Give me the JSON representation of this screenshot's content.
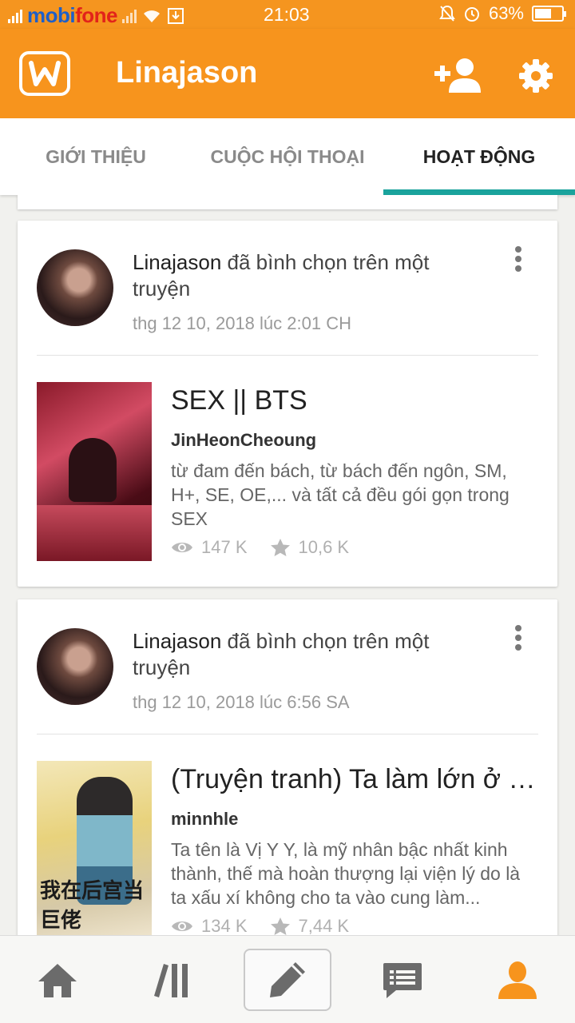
{
  "status_bar": {
    "carrier_part1": "mobi",
    "carrier_part2": "fone",
    "time": "21:03",
    "battery": "63%",
    "battery_level": 0.63
  },
  "app_bar": {
    "logo_letter": "w",
    "title": "Linajason",
    "icons": [
      "add-user-icon",
      "gear-icon"
    ]
  },
  "tabs": [
    {
      "label": "GIỚI THIỆU",
      "active": false
    },
    {
      "label": "CUỘC HỘI THOẠI",
      "active": false
    },
    {
      "label": "HOẠT ĐỘNG",
      "active": true
    }
  ],
  "activities": [
    {
      "user": "Linajason",
      "action": " đã bình chọn trên một truyện",
      "date": "thg 12 10, 2018 lúc 2:01 CH",
      "story": {
        "title": "SEX || BTS",
        "author": "JinHeonCheoung",
        "description": "từ đam đến bách, từ bách đến ngôn, SM, H+, SE, OE,...  và tất cả đều gói gọn trong SEX",
        "reads": "147 K",
        "votes": "10,6 K"
      }
    },
    {
      "user": "Linajason",
      "action": " đã bình chọn trên một truyện",
      "date": "thg 12 10, 2018 lúc 6:56 SA",
      "story": {
        "title": "(Truyện tranh) Ta làm lớn ở hậu cung",
        "author": "minnhle",
        "description": "Ta tên là Vị Y Y, là mỹ nhân bậc nhất kinh thành, thế mà hoàn thượng lại viện lý do là ta xấu xí không cho ta vào cung làm...",
        "reads": "134 K",
        "votes": "7,44 K",
        "cover_text": "我在后宫当巨佬"
      }
    }
  ],
  "bottom_nav": {
    "items": [
      "home-icon",
      "library-icon",
      "write-icon",
      "messages-icon",
      "profile-icon"
    ],
    "active": "profile-icon"
  },
  "colors": {
    "brand_orange": "#f7941d",
    "tab_indicator": "#1aa39c",
    "active_nav": "#f7941d",
    "inactive_nav": "#6b6b6b"
  }
}
